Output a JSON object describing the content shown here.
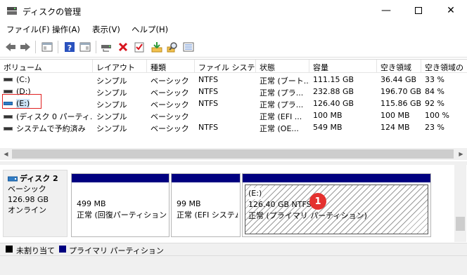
{
  "window": {
    "title": "ディスクの管理"
  },
  "menu": [
    "ファイル(F)",
    "操作(A)",
    "表示(V)",
    "ヘルプ(H)"
  ],
  "columns": [
    "ボリューム",
    "レイアウト",
    "種類",
    "ファイル システム",
    "状態",
    "容量",
    "空き領域",
    "空き領域の"
  ],
  "volumes": [
    {
      "name": "(C:)",
      "layout": "シンプル",
      "type": "ベーシック",
      "fs": "NTFS",
      "status": "正常 (ブート...",
      "capacity": "111.15 GB",
      "free": "36.44 GB",
      "pct": "33 %"
    },
    {
      "name": "(D:)",
      "layout": "シンプル",
      "type": "ベーシック",
      "fs": "NTFS",
      "status": "正常 (プラ...",
      "capacity": "232.88 GB",
      "free": "196.70 GB",
      "pct": "84 %"
    },
    {
      "name": "(E:)",
      "layout": "シンプル",
      "type": "ベーシック",
      "fs": "NTFS",
      "status": "正常 (プラ...",
      "capacity": "126.40 GB",
      "free": "115.86 GB",
      "pct": "92 %"
    },
    {
      "name": "(ディスク 0 パーティ...",
      "layout": "シンプル",
      "type": "ベーシック",
      "fs": "",
      "status": "正常 (EFI ...",
      "capacity": "100 MB",
      "free": "100 MB",
      "pct": "100 %"
    },
    {
      "name": "システムで予約済み",
      "layout": "シンプル",
      "type": "ベーシック",
      "fs": "NTFS",
      "status": "正常 (OE...",
      "capacity": "549 MB",
      "free": "124 MB",
      "pct": "23 %"
    }
  ],
  "disk": {
    "name": "ディスク 2",
    "kind": "ベーシック",
    "size": "126.98 GB",
    "state": "オンライン"
  },
  "partitions": [
    {
      "line1": "",
      "line2": "499 MB",
      "line3": "正常 (回復パーティション)"
    },
    {
      "line1": "",
      "line2": "99 MB",
      "line3": "正常 (EFI システム"
    },
    {
      "line1": "(E:)",
      "line2": "126.40 GB NTFS",
      "line3": "正常 (プライマリ パーティション)"
    }
  ],
  "badge": "1",
  "legend": [
    {
      "label": "未割り当て",
      "color": "#000000"
    },
    {
      "label": "プライマリ パーティション",
      "color": "#000080"
    }
  ],
  "icons": [
    "disk-mgmt-app-icon",
    "minimize-icon",
    "maximize-icon",
    "close-icon",
    "back-arrow-icon",
    "forward-arrow-icon",
    "console-tree-icon",
    "help-icon",
    "properties-icon",
    "connect-icon",
    "delete-icon",
    "check-icon",
    "import-icon",
    "search-icon",
    "list-icon"
  ]
}
